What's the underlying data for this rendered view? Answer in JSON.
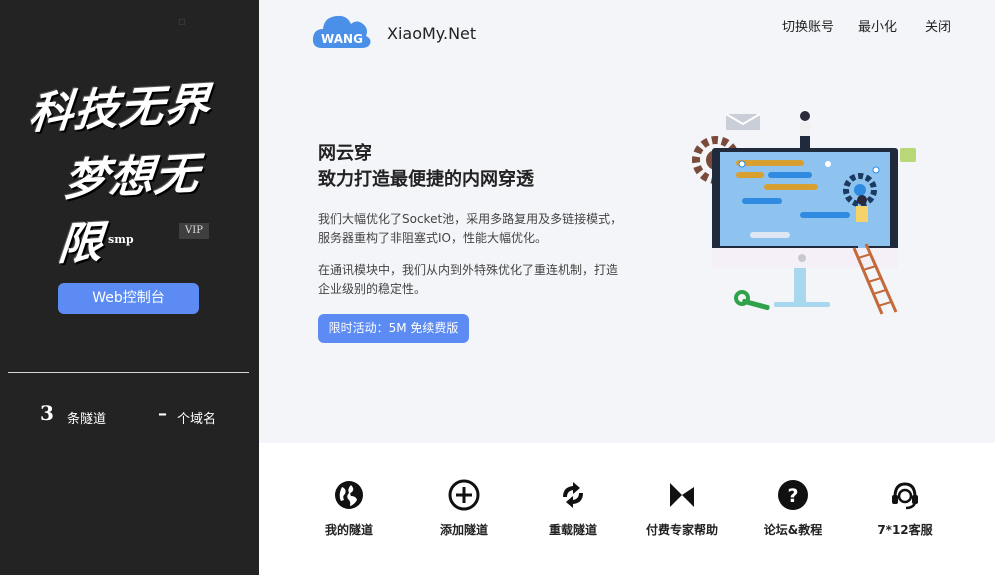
{
  "sidebar": {
    "slogan_line1": "科技无界",
    "slogan_line2": "梦想无限",
    "username": "smp",
    "vip_badge": "VIP",
    "web_console_button": "Web控制台",
    "tunnel_count": "3",
    "tunnel_label": "条隧道",
    "domain_count": "–",
    "domain_label": "个域名"
  },
  "header": {
    "logo_badge": "WANG",
    "site_name": "XiaoMy.Net",
    "links": [
      "切换账号",
      "最小化",
      "关闭"
    ]
  },
  "hero": {
    "title_line1": "网云穿",
    "title_line2": "致力打造最便捷的内网穿透",
    "desc1_line1": "我们大幅优化了Socket池，采用多路复用及多链接模式，",
    "desc1_line2": "服务器重构了非阻塞式IO，性能大幅优化。",
    "desc2_line1": "在通讯模块中，我们从内到外特殊优化了重连机制，打造",
    "desc2_line2": "企业级别的稳定性。",
    "promo_button": "限时活动：5M 免续费版"
  },
  "actions": [
    {
      "label": "我的隧道",
      "icon": "globe-icon"
    },
    {
      "label": "添加隧道",
      "icon": "plus-circle-icon"
    },
    {
      "label": "重载隧道",
      "icon": "reload-icon"
    },
    {
      "label": "付费专家帮助",
      "icon": "expert-icon"
    },
    {
      "label": "论坛&教程",
      "icon": "question-icon"
    },
    {
      "label": "7*12客服",
      "icon": "headset-icon"
    }
  ],
  "colors": {
    "accent": "#5b8bf3",
    "sidebar_bg": "#232323",
    "content_bg": "#f4f5f9"
  }
}
